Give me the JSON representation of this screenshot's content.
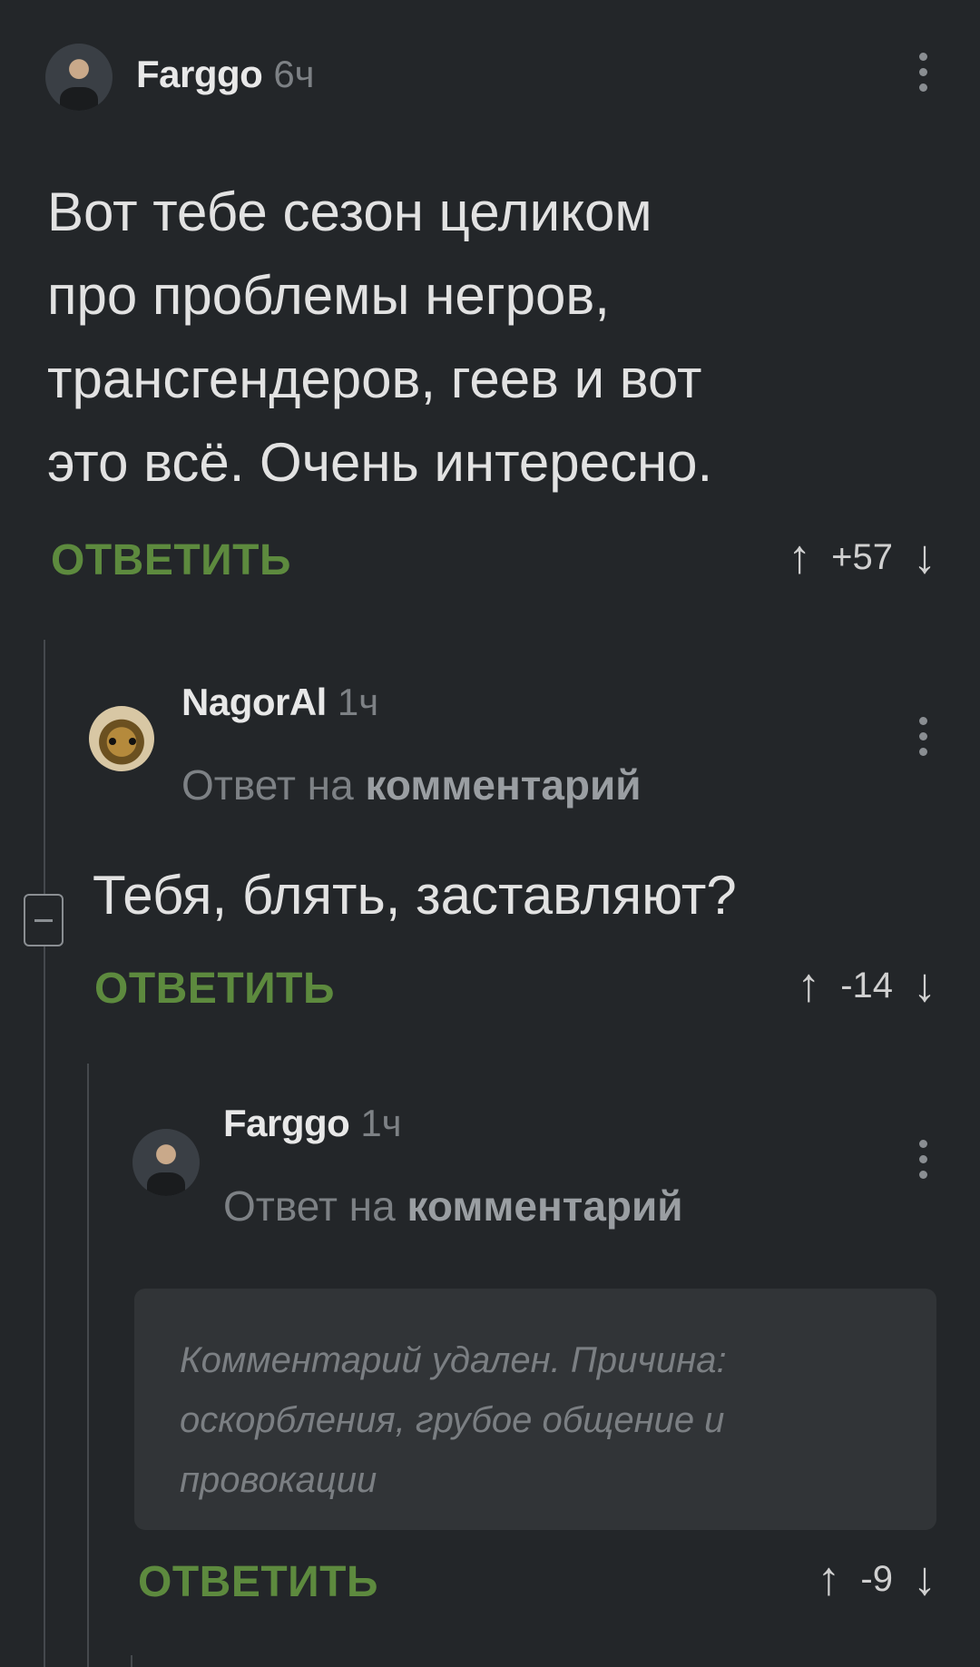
{
  "comments": [
    {
      "username": "Farggo",
      "time": "6ч",
      "text_lines": [
        "Вот тебе сезон целиком",
        "про проблемы негров,",
        "трансгендеров, геев и вот",
        "это всё. Очень интересно."
      ],
      "reply_label": "ОТВЕТИТЬ",
      "rating": "+57"
    },
    {
      "username": "NagorAl",
      "time": "1ч",
      "reply_prefix": "Ответ на",
      "reply_target": "комментарий",
      "text": "Тебя, блять, заставляют?",
      "reply_label": "ОТВЕТИТЬ",
      "rating": "-14"
    },
    {
      "username": "Farggo",
      "time": "1ч",
      "reply_prefix": "Ответ на",
      "reply_target": "комментарий",
      "deleted_lines": [
        "Комментарий удален. Причина:",
        "оскорбления, грубое общение и",
        "провокации"
      ],
      "reply_label": "ОТВЕТИТЬ",
      "rating": "-9"
    }
  ],
  "icons": {
    "upvote": "↑",
    "downvote": "↓"
  },
  "colors": {
    "background": "#232629",
    "reply_green": "#5d8a3e",
    "deleted_box": "#313437"
  }
}
